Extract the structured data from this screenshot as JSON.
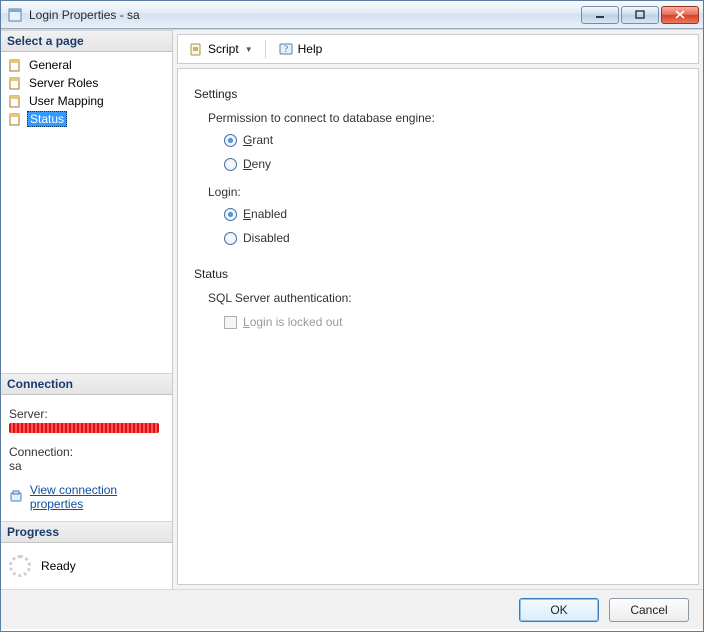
{
  "window": {
    "title": "Login Properties - sa"
  },
  "sidebar": {
    "select_page_header": "Select a page",
    "items": [
      {
        "label": "General"
      },
      {
        "label": "Server Roles"
      },
      {
        "label": "User Mapping"
      },
      {
        "label": "Status"
      }
    ],
    "selected_index": 3
  },
  "connection": {
    "header": "Connection",
    "server_label": "Server:",
    "connection_label": "Connection:",
    "connection_value": "sa",
    "view_props_link": "View connection properties"
  },
  "progress": {
    "header": "Progress",
    "status": "Ready"
  },
  "toolbar": {
    "script_label": "Script",
    "help_label": "Help"
  },
  "page": {
    "settings_title": "Settings",
    "perm_label": "Permission to connect to database engine:",
    "grant_label": "Grant",
    "deny_label": "Deny",
    "perm_value": "grant",
    "login_label": "Login:",
    "enabled_label": "Enabled",
    "disabled_label": "Disabled",
    "login_value": "enabled",
    "status_title": "Status",
    "sql_auth_label": "SQL Server authentication:",
    "locked_out_label": "Login is locked out",
    "locked_out_checked": false,
    "locked_out_enabled": false
  },
  "buttons": {
    "ok": "OK",
    "cancel": "Cancel"
  }
}
